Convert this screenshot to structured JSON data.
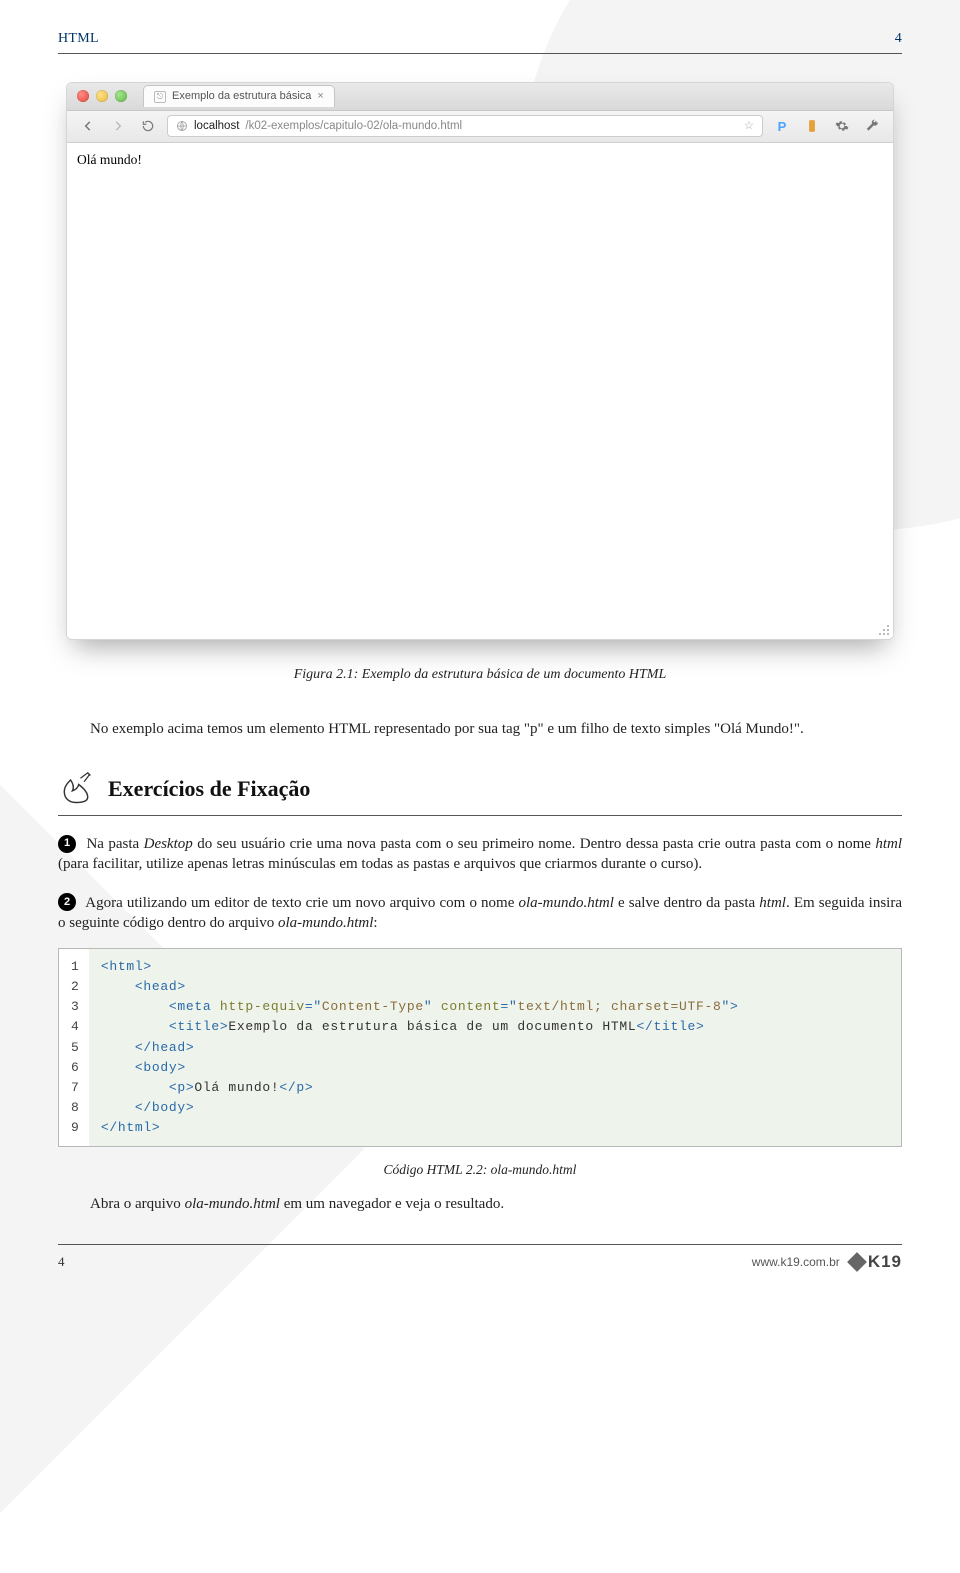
{
  "header": {
    "name": "HTML",
    "page": "4"
  },
  "browser": {
    "tab_title": "Exemplo da estrutura básica",
    "url_host": "localhost",
    "url_path": "/k02-exemplos/capitulo-02/ola-mundo.html",
    "page_text": "Olá mundo!"
  },
  "figure_caption": "Figura 2.1: Exemplo da estrutura básica de um documento HTML",
  "paragraph1": "No exemplo acima temos um elemento HTML representado por sua tag \"p\" e um filho de texto simples \"Olá Mundo!\".",
  "section_title": "Exercícios de Fixação",
  "ex1": {
    "n": "1",
    "text_before": "Na pasta ",
    "em1": "Desktop",
    "text_mid": " do seu usuário crie uma nova pasta com o seu primeiro nome. Dentro dessa pasta crie outra pasta com o nome ",
    "em2": "html",
    "text_after": " (para facilitar, utilize apenas letras minúsculas em todas as pastas e arquivos que criarmos durante o curso)."
  },
  "ex2": {
    "n": "2",
    "text_before": "Agora utilizando um editor de texto crie um novo arquivo com o nome ",
    "em1": "ola-mundo.html",
    "text_mid": " e salve dentro da pasta ",
    "em2": "html",
    "text_mid2": ". Em seguida insira o seguinte código dentro do arquivo ",
    "em3": "ola-mundo.html",
    "text_after": ":"
  },
  "code": {
    "lines": [
      "1",
      "2",
      "3",
      "4",
      "5",
      "6",
      "7",
      "8",
      "9"
    ],
    "l1_a": "<",
    "l1_b": "html",
    "l1_c": ">",
    "l2_a": "<",
    "l2_b": "head",
    "l2_c": ">",
    "l3_a": "<",
    "l3_b": "meta",
    "l3_c": " http-equiv",
    "l3_d": "=\"",
    "l3_e": "Content-Type",
    "l3_f": "\" ",
    "l3_g": "content",
    "l3_h": "=\"",
    "l3_i": "text/html; charset=UTF-8",
    "l3_j": "\">",
    "l4_a": "<",
    "l4_b": "title",
    "l4_c": ">",
    "l4_d": "Exemplo da estrutura básica de um documento HTML",
    "l4_e": "</",
    "l4_f": "title",
    "l4_g": ">",
    "l5_a": "</",
    "l5_b": "head",
    "l5_c": ">",
    "l6_a": "<",
    "l6_b": "body",
    "l6_c": ">",
    "l7_a": "<",
    "l7_b": "p",
    "l7_c": ">",
    "l7_d": "Olá mundo!",
    "l7_e": "</",
    "l7_f": "p",
    "l7_g": ">",
    "l8_a": "</",
    "l8_b": "body",
    "l8_c": ">",
    "l9_a": "</",
    "l9_b": "html",
    "l9_c": ">"
  },
  "code_caption": "Código HTML 2.2: ola-mundo.html",
  "closing_before": "Abra o arquivo ",
  "closing_em": "ola-mundo.html",
  "closing_after": " em um navegador e veja o resultado.",
  "footer": {
    "left": "4",
    "url": "www.k19.com.br",
    "logo": "K19"
  }
}
